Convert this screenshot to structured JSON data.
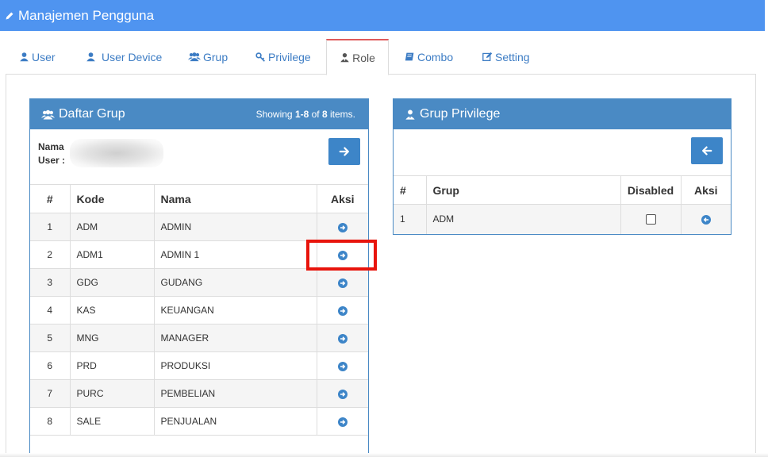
{
  "header": {
    "title": "Manajemen Pengguna",
    "icon": "pencil-icon"
  },
  "tabs": [
    {
      "label": "User",
      "icon": "user-icon"
    },
    {
      "label": "User Device",
      "icon": "user-icon"
    },
    {
      "label": "Grup",
      "icon": "users-icon"
    },
    {
      "label": "Privilege",
      "icon": "key-icon"
    },
    {
      "label": "Role",
      "icon": "user-tie-icon",
      "active": true
    },
    {
      "label": "Combo",
      "icon": "book-icon"
    },
    {
      "label": "Setting",
      "icon": "edit-icon"
    }
  ],
  "daftar_grup": {
    "title": "Daftar Grup",
    "summary": {
      "prefix": "Showing ",
      "range": "1-8",
      "mid": " of ",
      "total": "8",
      "suffix": " items."
    },
    "info_nama_label": "Nama",
    "info_user_label": "User :",
    "columns": [
      "#",
      "Kode",
      "Nama",
      "Aksi"
    ],
    "rows": [
      {
        "no": "1",
        "kode": "ADM",
        "nama": "ADMIN"
      },
      {
        "no": "2",
        "kode": "ADM1",
        "nama": "ADMIN 1"
      },
      {
        "no": "3",
        "kode": "GDG",
        "nama": "GUDANG"
      },
      {
        "no": "4",
        "kode": "KAS",
        "nama": "KEUANGAN"
      },
      {
        "no": "5",
        "kode": "MNG",
        "nama": "MANAGER"
      },
      {
        "no": "6",
        "kode": "PRD",
        "nama": "PRODUKSI"
      },
      {
        "no": "7",
        "kode": "PURC",
        "nama": "PEMBELIAN"
      },
      {
        "no": "8",
        "kode": "SALE",
        "nama": "PENJUALAN"
      }
    ]
  },
  "grup_privilege": {
    "title": "Grup Privilege",
    "columns": [
      "#",
      "Grup",
      "Disabled",
      "Aksi"
    ],
    "rows": [
      {
        "no": "1",
        "grup": "ADM",
        "disabled": false
      }
    ]
  },
  "colors": {
    "header_bg": "#4f94f0",
    "panel": "#4a8ac4",
    "active_tab_border": "#e05b5b",
    "highlight": "#e8140c"
  }
}
